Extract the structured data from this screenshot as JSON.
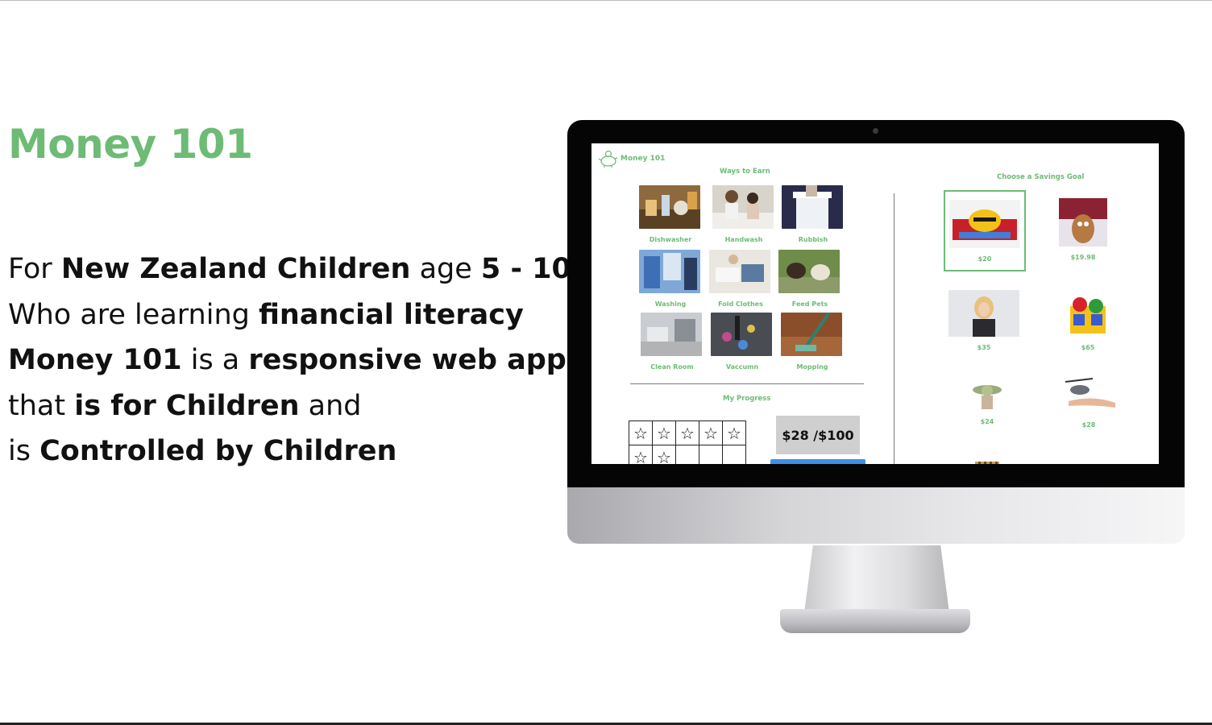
{
  "slide": {
    "title": "Money 101",
    "pitch": {
      "l1_a": "For ",
      "l1_b": "New Zealand Children",
      "l1_c": " age ",
      "l1_d": "5 - 10",
      "l2_a": "Who are learning ",
      "l2_b": "financial literacy",
      "l3_a": "Money 101",
      "l3_b": " is a ",
      "l3_c": "responsive web app",
      "l4_a": "that ",
      "l4_b": "is for Children",
      "l4_c": " and",
      "l5_a": "is ",
      "l5_b": "Controlled by Children"
    }
  },
  "app": {
    "brand": "Money 101",
    "logo_icon": "piggy-bank-icon",
    "earn": {
      "title": "Ways to Earn",
      "chores": [
        {
          "label": "Dishwasher",
          "icon": "dishwasher-photo"
        },
        {
          "label": "Handwash",
          "icon": "handwash-photo"
        },
        {
          "label": "Rubbish",
          "icon": "rubbish-bin-photo"
        },
        {
          "label": "Washing",
          "icon": "washing-line-photo"
        },
        {
          "label": "Fold Clothes",
          "icon": "fold-clothes-photo"
        },
        {
          "label": "Feed Pets",
          "icon": "feed-pets-photo"
        },
        {
          "label": "Clean Room",
          "icon": "clean-room-photo"
        },
        {
          "label": "Vaccumn",
          "icon": "vacuum-photo"
        },
        {
          "label": "Mopping",
          "icon": "mopping-photo"
        }
      ]
    },
    "progress": {
      "title": "My Progress",
      "stars_row1": [
        "☆",
        "☆",
        "☆",
        "☆",
        "☆"
      ],
      "stars_row2": [
        "☆",
        "☆",
        "",
        "",
        ""
      ],
      "amount": "$28 /$100",
      "saved": 28,
      "goal": 100
    },
    "savings": {
      "title": "Choose a Savings Goal",
      "goals": [
        {
          "price": "$20",
          "icon": "buzzy-bee-toy-photo",
          "selected": true
        },
        {
          "price": "$19.98",
          "icon": "potato-head-toy-photo",
          "selected": false
        },
        {
          "price": "$35",
          "icon": "barbie-doll-photo",
          "selected": false
        },
        {
          "price": "$65",
          "icon": "mario-luigi-toy-photo",
          "selected": false
        },
        {
          "price": "$24",
          "icon": "baby-yoda-toy-photo",
          "selected": false
        },
        {
          "price": "$28",
          "icon": "toy-helicopter-photo",
          "selected": false
        }
      ]
    },
    "colors": {
      "accent": "#6dbb75",
      "button": "#3f8fe6",
      "progress_box": "#cfcfcf"
    }
  }
}
